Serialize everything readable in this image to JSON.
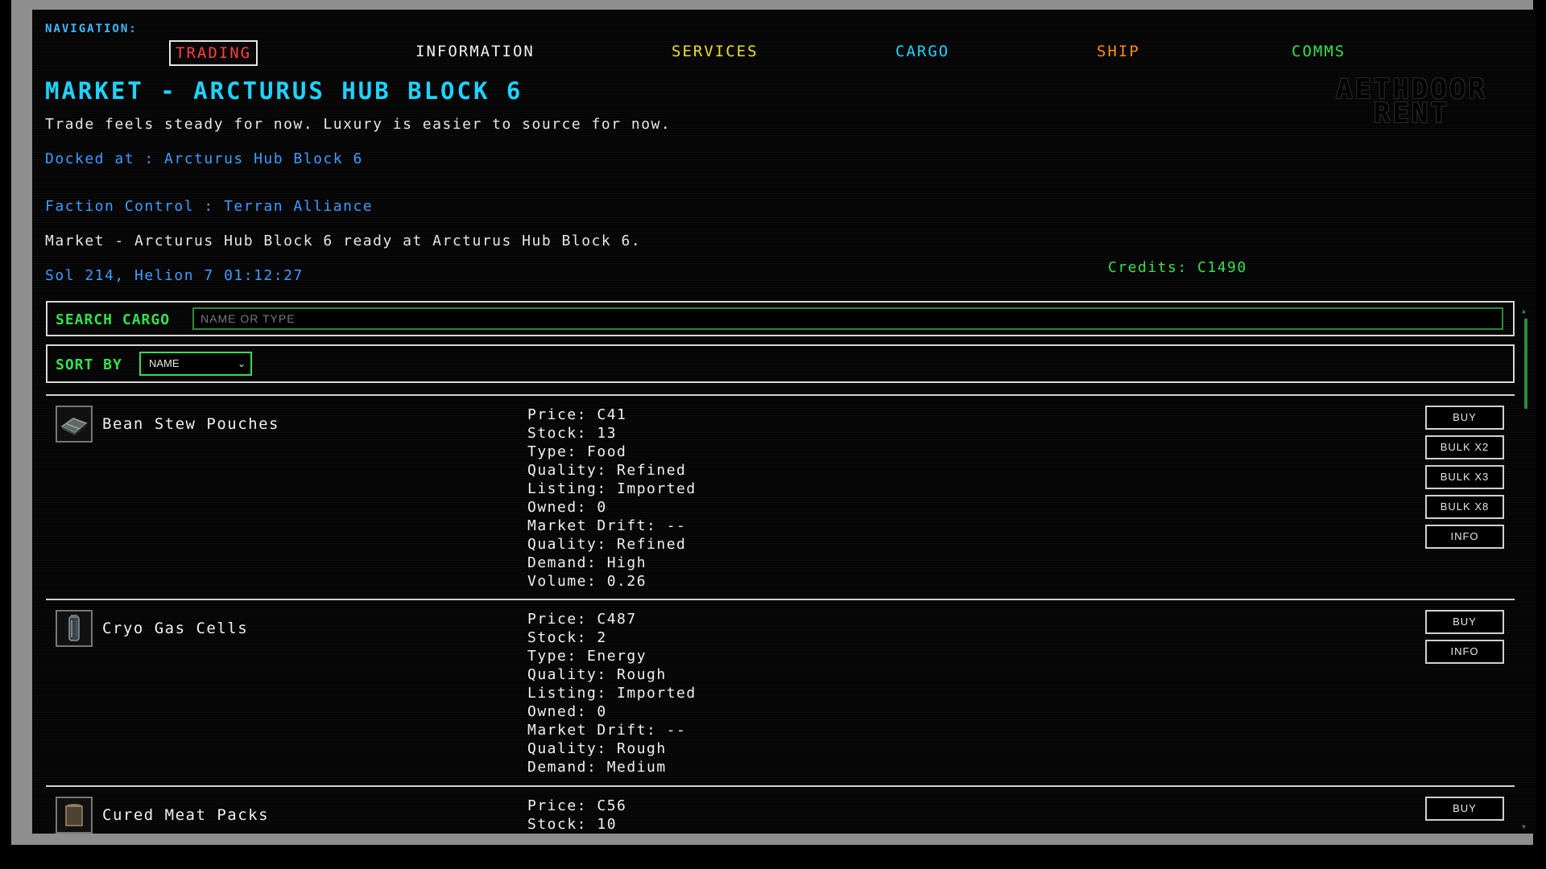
{
  "nav": {
    "label": "NAVIGATION:",
    "items": [
      {
        "label": "TRADING",
        "color": "#ff4040"
      },
      {
        "label": "INFORMATION",
        "color": "#f0f0f0"
      },
      {
        "label": "SERVICES",
        "color": "#f0e020"
      },
      {
        "label": "CARGO",
        "color": "#1fd3ff"
      },
      {
        "label": "SHIP",
        "color": "#ff8a1a"
      },
      {
        "label": "COMMS",
        "color": "#35e04f"
      }
    ]
  },
  "logo": {
    "line1": "AETHDOOR",
    "line2": "RENT"
  },
  "header": {
    "title": "MARKET - ARCTURUS HUB BLOCK 6",
    "tagline": "Trade feels steady for now. Luxury is easier to source for now.",
    "docked": "Docked at : Arcturus Hub Block 6",
    "faction": "Faction Control : Terran Alliance",
    "status": "Market - Arcturus Hub Block 6 ready at Arcturus Hub Block 6.",
    "time": "Sol 214, Helion 7 01:12:27",
    "credits": "Credits: C1490"
  },
  "search": {
    "label": "SEARCH CARGO",
    "placeholder": "NAME OR TYPE"
  },
  "sort": {
    "label": "SORT BY",
    "selected": "NAME"
  },
  "items": [
    {
      "name": "Bean Stew Pouches",
      "icon": "food-crate-icon",
      "props": [
        "Price: C41",
        "Stock: 13",
        "Type: Food",
        "Quality: Refined",
        "Listing: Imported",
        "Owned: 0",
        "Market Drift: --",
        "Quality: Refined",
        "Demand: High",
        "Volume: 0.26"
      ],
      "buttons": [
        "BUY",
        "BULK X2",
        "BULK X3",
        "BULK X8",
        "INFO"
      ]
    },
    {
      "name": "Cryo Gas Cells",
      "icon": "gas-cylinder-icon",
      "props": [
        "Price: C487",
        "Stock: 2",
        "Type: Energy",
        "Quality: Rough",
        "Listing: Imported",
        "Owned: 0",
        "Market Drift: --",
        "Quality: Rough",
        "Demand: Medium"
      ],
      "buttons": [
        "BUY",
        "INFO"
      ]
    },
    {
      "name": "Cured Meat Packs",
      "icon": "meat-can-icon",
      "props": [
        "Price: C56",
        "Stock: 10"
      ],
      "buttons": [
        "BUY"
      ]
    }
  ]
}
